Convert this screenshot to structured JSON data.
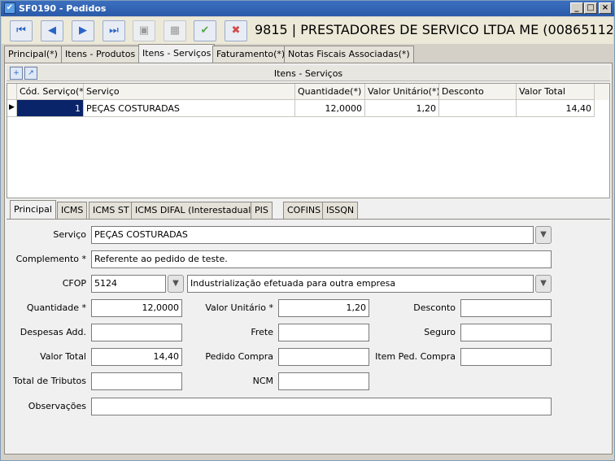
{
  "window": {
    "title": "SF0190 - Pedidos",
    "app_icon": "check-icon",
    "controls": [
      "_",
      "□",
      "×"
    ]
  },
  "toolbar": {
    "buttons": [
      {
        "name": "first-record-button",
        "icon": "first-icon",
        "glyph": "⏮"
      },
      {
        "name": "previous-record-button",
        "icon": "previous-icon",
        "glyph": "◀"
      },
      {
        "name": "next-record-button",
        "icon": "next-icon",
        "glyph": "▶"
      },
      {
        "name": "last-record-button",
        "icon": "last-icon",
        "glyph": "⏭"
      },
      {
        "name": "new-record-button",
        "icon": "new-document-icon",
        "glyph": "▣"
      },
      {
        "name": "edit-record-button",
        "icon": "edit-icon",
        "glyph": "▦"
      },
      {
        "name": "confirm-button",
        "icon": "check-icon",
        "glyph": "✔"
      },
      {
        "name": "cancel-button",
        "icon": "cancel-icon",
        "glyph": "✖"
      }
    ],
    "record_title": "9815 | PRESTADORES DE SERVICO LTDA ME (00865112"
  },
  "main_tabs": [
    {
      "label": "Principal(*)",
      "active": false
    },
    {
      "label": "Itens - Produtos",
      "active": false
    },
    {
      "label": "Itens - Serviços",
      "active": true
    },
    {
      "label": "Faturamento(*)",
      "active": false
    },
    {
      "label": "Notas Fiscais Associadas(*)",
      "active": false
    }
  ],
  "grid": {
    "title": "Itens - Serviços",
    "icons": [
      "add-row-icon",
      "export-icon"
    ],
    "columns": [
      "Cód. Serviço(*)",
      "Serviço",
      "Quantidade(*)",
      "Valor Unitário(*)",
      "Desconto",
      "Valor Total"
    ],
    "rows": [
      {
        "codigo": "1",
        "servico": "PEÇAS COSTURADAS",
        "quantidade": "12,0000",
        "valor_unitario": "1,20",
        "desconto": "",
        "valor_total": "14,40"
      }
    ]
  },
  "sub_tabs": [
    {
      "label": "Principal",
      "active": true
    },
    {
      "label": "ICMS",
      "active": false
    },
    {
      "label": "ICMS ST",
      "active": false
    },
    {
      "label": "ICMS DIFAL (Interestadual)",
      "active": false
    },
    {
      "label": "PIS",
      "active": false
    },
    {
      "label": "COFINS",
      "active": false
    },
    {
      "label": "ISSQN",
      "active": false
    }
  ],
  "form": {
    "servico": {
      "label": "Serviço",
      "value": "PEÇAS COSTURADAS"
    },
    "complemento": {
      "label": "Complemento *",
      "value": "Referente ao pedido de teste."
    },
    "cfop": {
      "label": "CFOP",
      "code": "5124",
      "description": "Industrialização efetuada para outra empresa"
    },
    "quantidade": {
      "label": "Quantidade *",
      "value": "12,0000"
    },
    "valor_unitario": {
      "label": "Valor Unitário *",
      "value": "1,20"
    },
    "desconto": {
      "label": "Desconto",
      "value": ""
    },
    "despesas_add": {
      "label": "Despesas Add.",
      "value": ""
    },
    "frete": {
      "label": "Frete",
      "value": ""
    },
    "seguro": {
      "label": "Seguro",
      "value": ""
    },
    "valor_total": {
      "label": "Valor Total",
      "value": "14,40"
    },
    "pedido_compra": {
      "label": "Pedido Compra",
      "value": ""
    },
    "item_ped_compra": {
      "label": "Item Ped. Compra",
      "value": ""
    },
    "total_tributos": {
      "label": "Total de Tributos",
      "value": ""
    },
    "ncm": {
      "label": "NCM",
      "value": ""
    },
    "observacoes": {
      "label": "Observações",
      "value": ""
    }
  },
  "colors": {
    "titlebar": "#2a5aa8",
    "selection": "#0a246a",
    "panel": "#f0f0f0"
  }
}
